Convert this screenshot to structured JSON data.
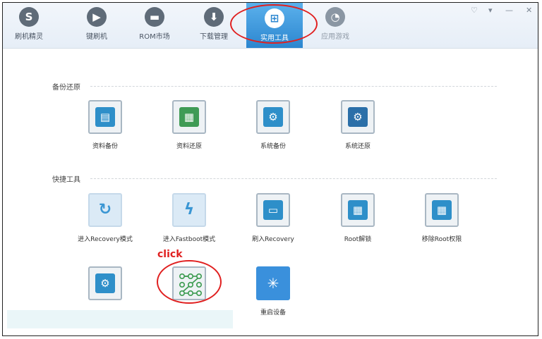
{
  "nav": {
    "items": [
      {
        "label": "刷机精灵",
        "icon": "S"
      },
      {
        "label": "键刷机",
        "icon": "▶"
      },
      {
        "label": "ROM市场",
        "icon": "▬"
      },
      {
        "label": "下载管理",
        "icon": "⬇"
      },
      {
        "label": "实用工具",
        "icon": "⊞"
      },
      {
        "label": "应用游戏",
        "icon": "◔"
      }
    ],
    "active_index": 4
  },
  "window_controls": [
    "♡",
    "▾",
    "—",
    "✕"
  ],
  "sections": {
    "backup": {
      "title": "备份还原"
    },
    "quick": {
      "title": "快捷工具"
    }
  },
  "tools": {
    "backup": [
      {
        "label": "资料备份",
        "icon": "▤"
      },
      {
        "label": "资料还原",
        "icon": "▦"
      },
      {
        "label": "系统备份",
        "icon": "⚙"
      },
      {
        "label": "系统还原",
        "icon": "⚙"
      }
    ],
    "quick_row1": [
      {
        "label": "进入Recovery模式",
        "icon": "↻"
      },
      {
        "label": "进入Fastboot模式",
        "icon": "ϟ"
      },
      {
        "label": "刷入Recovery",
        "icon": "▭"
      },
      {
        "label": "Root解锁",
        "icon": "▦"
      },
      {
        "label": "移除Root权限",
        "icon": "▦"
      }
    ],
    "quick_row2": [
      {
        "label": "",
        "icon": "⚙"
      },
      {
        "label": "",
        "icon": "pattern-lock"
      },
      {
        "label": "重启设备",
        "icon": "✳"
      }
    ]
  },
  "annotation": {
    "click": "click"
  }
}
